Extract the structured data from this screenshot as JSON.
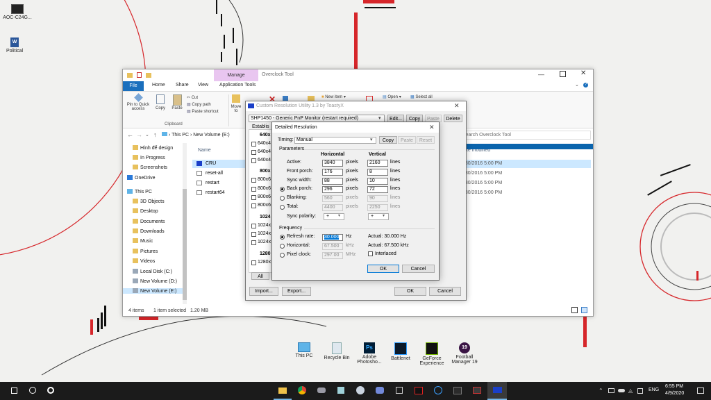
{
  "desktop": {
    "icons": [
      {
        "label": "AOC-C24G...",
        "icon": "monitor-icon"
      },
      {
        "label": "Political",
        "icon": "word-document-icon"
      }
    ],
    "dock": [
      {
        "label": "This PC",
        "icon": "this-pc-icon"
      },
      {
        "label": "Recycle Bin",
        "icon": "recycle-bin-icon"
      },
      {
        "label": "Adobe Photosho...",
        "icon": "photoshop-icon"
      },
      {
        "label": "Battlenet",
        "icon": "battlenet-icon"
      },
      {
        "label": "GeForce Experience",
        "icon": "geforce-icon"
      },
      {
        "label": "Football Manager 19",
        "icon": "football-manager-icon"
      }
    ]
  },
  "explorer": {
    "tab_context": "Manage",
    "title": "Overclock Tool",
    "tabs": [
      "File",
      "Home",
      "Share",
      "View",
      "Application Tools"
    ],
    "ribbon": {
      "pin_label": "Pin to Quick access",
      "copy_label": "Copy",
      "paste_label": "Paste",
      "cut_label": "Cut",
      "copy_path_label": "Copy path",
      "paste_shortcut_label": "Paste shortcut",
      "clipboard_group": "Clipboard",
      "move_label": "Move to",
      "new_item_label": "New item",
      "open_label": "Open",
      "select_all_label": "Select all"
    },
    "address": {
      "crumbs": [
        "This PC",
        "New Volume (E:)"
      ],
      "search_placeholder": "Search Overclock Tool"
    },
    "nav": [
      {
        "label": "Hình để design",
        "type": "folder"
      },
      {
        "label": "In Progress",
        "type": "folder"
      },
      {
        "label": "Screenshots",
        "type": "folder"
      },
      {
        "label": "OneDrive",
        "type": "cloud"
      },
      {
        "label": "This PC",
        "type": "pc"
      },
      {
        "label": "3D Objects",
        "type": "folder"
      },
      {
        "label": "Desktop",
        "type": "folder"
      },
      {
        "label": "Documents",
        "type": "folder"
      },
      {
        "label": "Downloads",
        "type": "folder"
      },
      {
        "label": "Music",
        "type": "folder"
      },
      {
        "label": "Pictures",
        "type": "folder"
      },
      {
        "label": "Videos",
        "type": "folder"
      },
      {
        "label": "Local Disk (C:)",
        "type": "drive"
      },
      {
        "label": "New Volume (D:)",
        "type": "drive"
      },
      {
        "label": "New Volume (E:)",
        "type": "drive"
      }
    ],
    "columns": {
      "name": "Name",
      "date_modified": "ate modified"
    },
    "files": [
      {
        "name": "CRU",
        "date": "3/30/2016 5:00 PM"
      },
      {
        "name": "reset-all",
        "date": "3/30/2016 5:00 PM"
      },
      {
        "name": "restart",
        "date": "3/30/2016 5:00 PM"
      },
      {
        "name": "restart64",
        "date": "3/30/2016 5:00 PM"
      }
    ],
    "status": {
      "items": "4 items",
      "selected": "1 item selected",
      "size": "1.20 MB"
    }
  },
  "cru": {
    "title": "Custom Resolution Utility 1.3 by ToastyX",
    "monitor": "SHP1450 - Generic PnP Monitor (restart required)",
    "buttons": {
      "edit": "Edit...",
      "copy": "Copy",
      "paste": "Paste",
      "delete": "Delete",
      "all": "All",
      "import": "Import...",
      "export": "Export...",
      "ok": "OK",
      "cancel": "Cancel"
    },
    "established_label": "Establis",
    "list": [
      {
        "text": "640x",
        "kind": "header"
      },
      {
        "text": "640x4",
        "kind": "item"
      },
      {
        "text": "640x4",
        "kind": "item"
      },
      {
        "text": "640x4",
        "kind": "item"
      },
      {
        "text": "800x",
        "kind": "header"
      },
      {
        "text": "800x6",
        "kind": "item"
      },
      {
        "text": "800x6",
        "kind": "item"
      },
      {
        "text": "800x6",
        "kind": "item"
      },
      {
        "text": "800x6",
        "kind": "item"
      },
      {
        "text": "1024",
        "kind": "header"
      },
      {
        "text": "1024x",
        "kind": "item"
      },
      {
        "text": "1024x",
        "kind": "item"
      },
      {
        "text": "1024x",
        "kind": "item"
      },
      {
        "text": "1280",
        "kind": "header"
      },
      {
        "text": "1280x",
        "kind": "item"
      }
    ]
  },
  "dialog": {
    "title": "Detailed Resolution",
    "timing_label": "Timing:",
    "timing_value": "Manual",
    "buttons": {
      "copy": "Copy",
      "paste": "Paste",
      "reset": "Reset",
      "ok": "OK",
      "cancel": "Cancel"
    },
    "parameters_label": "Parameters",
    "horizontal_label": "Horizontal",
    "vertical_label": "Vertical",
    "rows": [
      {
        "label": "Active:",
        "h": "3840",
        "hu": "pixels",
        "v": "2160",
        "vu": "lines",
        "control": "none",
        "enabled": true
      },
      {
        "label": "Front porch:",
        "h": "176",
        "hu": "pixels",
        "v": "8",
        "vu": "lines",
        "control": "none",
        "enabled": true
      },
      {
        "label": "Sync width:",
        "h": "88",
        "hu": "pixels",
        "v": "10",
        "vu": "lines",
        "control": "none",
        "enabled": true
      },
      {
        "label": "Back porch:",
        "h": "296",
        "hu": "pixels",
        "v": "72",
        "vu": "lines",
        "control": "radio-on",
        "enabled": true
      },
      {
        "label": "Blanking:",
        "h": "560",
        "hu": "pixels",
        "v": "90",
        "vu": "lines",
        "control": "radio",
        "enabled": false
      },
      {
        "label": "Total:",
        "h": "4400",
        "hu": "pixels",
        "v": "2250",
        "vu": "lines",
        "control": "radio",
        "enabled": false
      }
    ],
    "sync_polarity_label": "Sync polarity:",
    "sync_h": "+",
    "sync_v": "+",
    "frequency_label": "Frequency",
    "freq_rows": [
      {
        "label": "Refresh rate:",
        "value": "30.000",
        "unit": "Hz",
        "actual": "Actual: 30.000 Hz",
        "selected": true
      },
      {
        "label": "Horizontal:",
        "value": "67.500",
        "unit": "kHz",
        "actual": "Actual: 67.500 kHz",
        "selected": false
      },
      {
        "label": "Pixel clock:",
        "value": "297.00",
        "unit": "MHz",
        "actual": "",
        "selected": false
      }
    ],
    "interlaced_label": "Interlaced"
  },
  "taskbar": {
    "time": "6:55 PM",
    "date": "4/9/2020",
    "lang": "ENG"
  }
}
